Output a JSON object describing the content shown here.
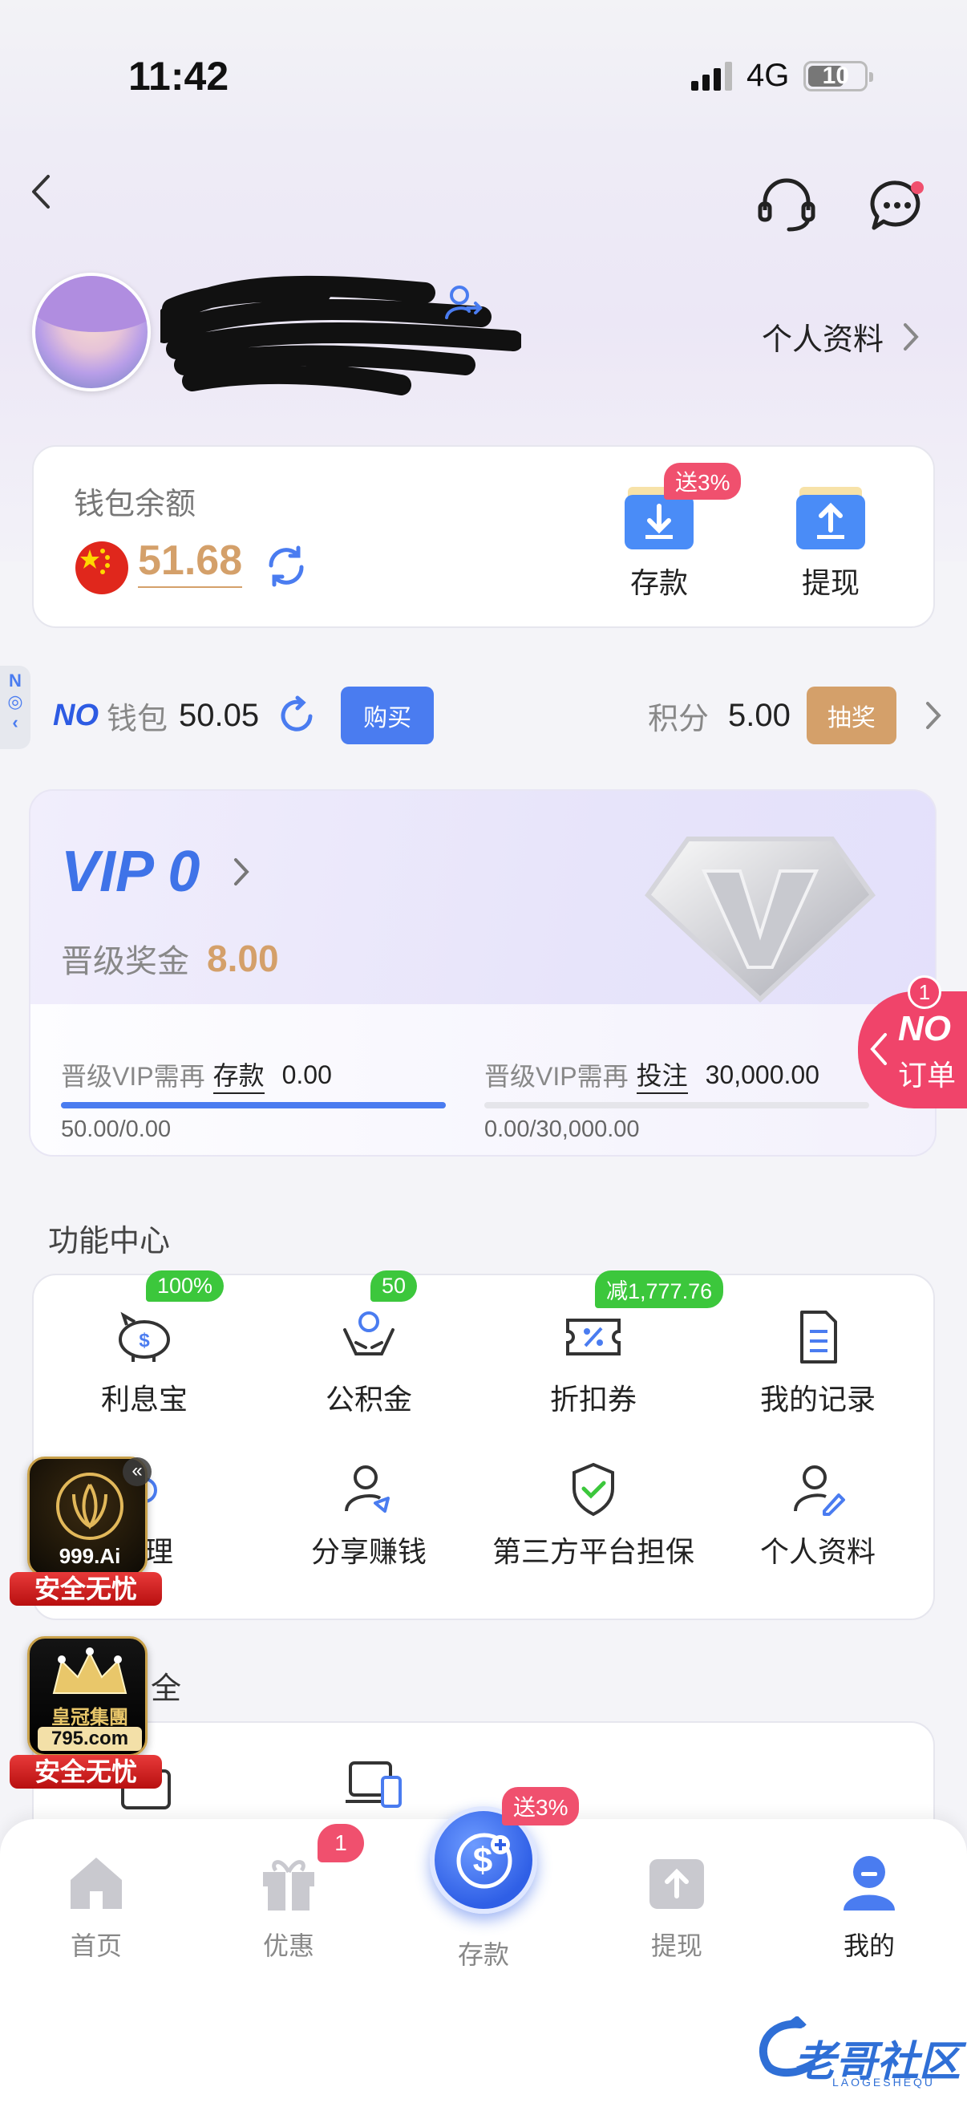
{
  "status": {
    "time": "11:42",
    "network": "4G",
    "battery": "10"
  },
  "header": {
    "profile_link": "个人资料"
  },
  "wallet": {
    "title": "钱包余额",
    "balance": "51.68",
    "deposit_label": "存款",
    "deposit_badge": "送3%",
    "withdraw_label": "提现"
  },
  "no_wallet": {
    "logo": "NO",
    "label": "钱包",
    "value": "50.05",
    "buy_label": "购买",
    "points_label": "积分",
    "points_value": "5.00",
    "lottery_label": "抽奖"
  },
  "vip": {
    "title": "VIP 0",
    "bonus_label": "晋级奖金",
    "bonus_value": "8.00",
    "req1_label": "晋级VIP需再",
    "req1_type": "存款",
    "req1_value": "0.00",
    "req1_progress_text": "50.00/0.00",
    "req1_progress": 1.0,
    "req2_label": "晋级VIP需再",
    "req2_type": "投注",
    "req2_value": "30,000.00",
    "req2_progress_text": "0.00/30,000.00",
    "req2_progress": 0.0
  },
  "order_float": {
    "count": "1",
    "logo": "NO",
    "label": "订单"
  },
  "functions": {
    "title": "功能中心",
    "items": [
      {
        "label": "利息宝",
        "badge": "100%",
        "icon": "piggy-bank-icon"
      },
      {
        "label": "公积金",
        "badge": "50",
        "icon": "hands-coin-icon"
      },
      {
        "label": "折扣券",
        "badge": "减1,777.76",
        "icon": "coupon-icon"
      },
      {
        "label": "我的记录",
        "icon": "document-icon"
      },
      {
        "label": "管理",
        "icon": "manage-icon"
      },
      {
        "label": "分享赚钱",
        "icon": "share-user-icon"
      },
      {
        "label": "第三方平台担保",
        "icon": "shield-check-icon"
      },
      {
        "label": "个人资料",
        "icon": "user-edit-icon"
      }
    ]
  },
  "security": {
    "title_fragment": "全"
  },
  "ads": [
    {
      "brand": "999.Ai",
      "tag": "安全无忧"
    },
    {
      "brand": "皇冠集團",
      "url": "795.com",
      "tag": "安全无忧"
    }
  ],
  "tabbar": {
    "items": [
      {
        "label": "首页",
        "icon": "home-icon"
      },
      {
        "label": "优惠",
        "icon": "gift-icon",
        "badge": "1"
      },
      {
        "label": "存款",
        "icon": "deposit-coin-icon",
        "badge": "送3%"
      },
      {
        "label": "提现",
        "icon": "withdraw-icon"
      },
      {
        "label": "我的",
        "icon": "profile-icon"
      }
    ]
  },
  "watermark": {
    "text": "老哥社区",
    "sub": "LAOGESHEQU"
  },
  "colors": {
    "accent": "#4a7cf0",
    "gold": "#d4a06a",
    "green_badge": "#3cc73c",
    "red_badge": "#f0506e"
  }
}
